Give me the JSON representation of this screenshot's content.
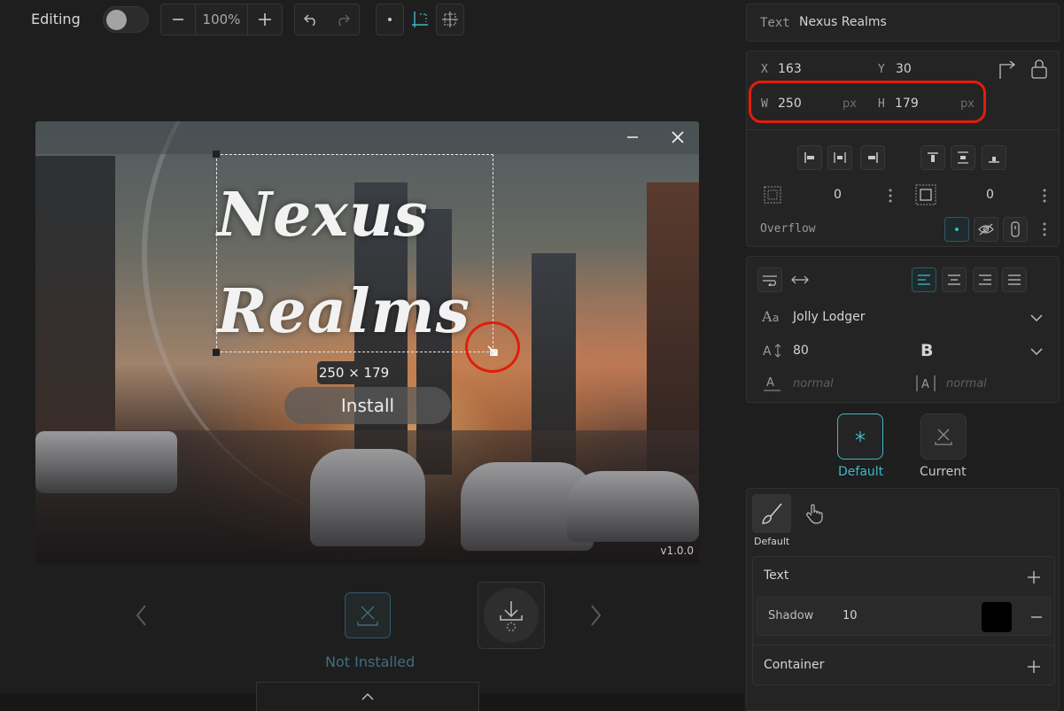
{
  "toolbar": {
    "mode_label": "Editing",
    "zoom_value": "100%"
  },
  "canvas": {
    "title_line1": "Nexus",
    "title_line2": "Realms",
    "size_tooltip": "250 × 179",
    "install_label": "Install",
    "version": "v1.0.0"
  },
  "carousel": {
    "status_label": "Not Installed"
  },
  "panel": {
    "element_type": "Text",
    "element_name": "Nexus Realms",
    "x_label": "X",
    "x_value": "163",
    "y_label": "Y",
    "y_value": "30",
    "w_label": "W",
    "w_value": "250",
    "w_unit": "px",
    "h_label": "H",
    "h_value": "179",
    "h_unit": "px",
    "border_value": "0",
    "padding_value": "0",
    "overflow_label": "Overflow",
    "font_family": "Jolly Lodger",
    "font_size": "80",
    "font_weight": "B",
    "letter_spacing": "normal",
    "line_height": "normal",
    "state_default_label": "Default",
    "state_current_label": "Current",
    "style_tab_label": "Default",
    "text_section_label": "Text",
    "shadow_label": "Shadow",
    "shadow_value": "10",
    "shadow_color": "#000000",
    "container_section_label": "Container"
  },
  "colors": {
    "accent": "#3fb8c9",
    "highlight": "#e11d0b"
  }
}
